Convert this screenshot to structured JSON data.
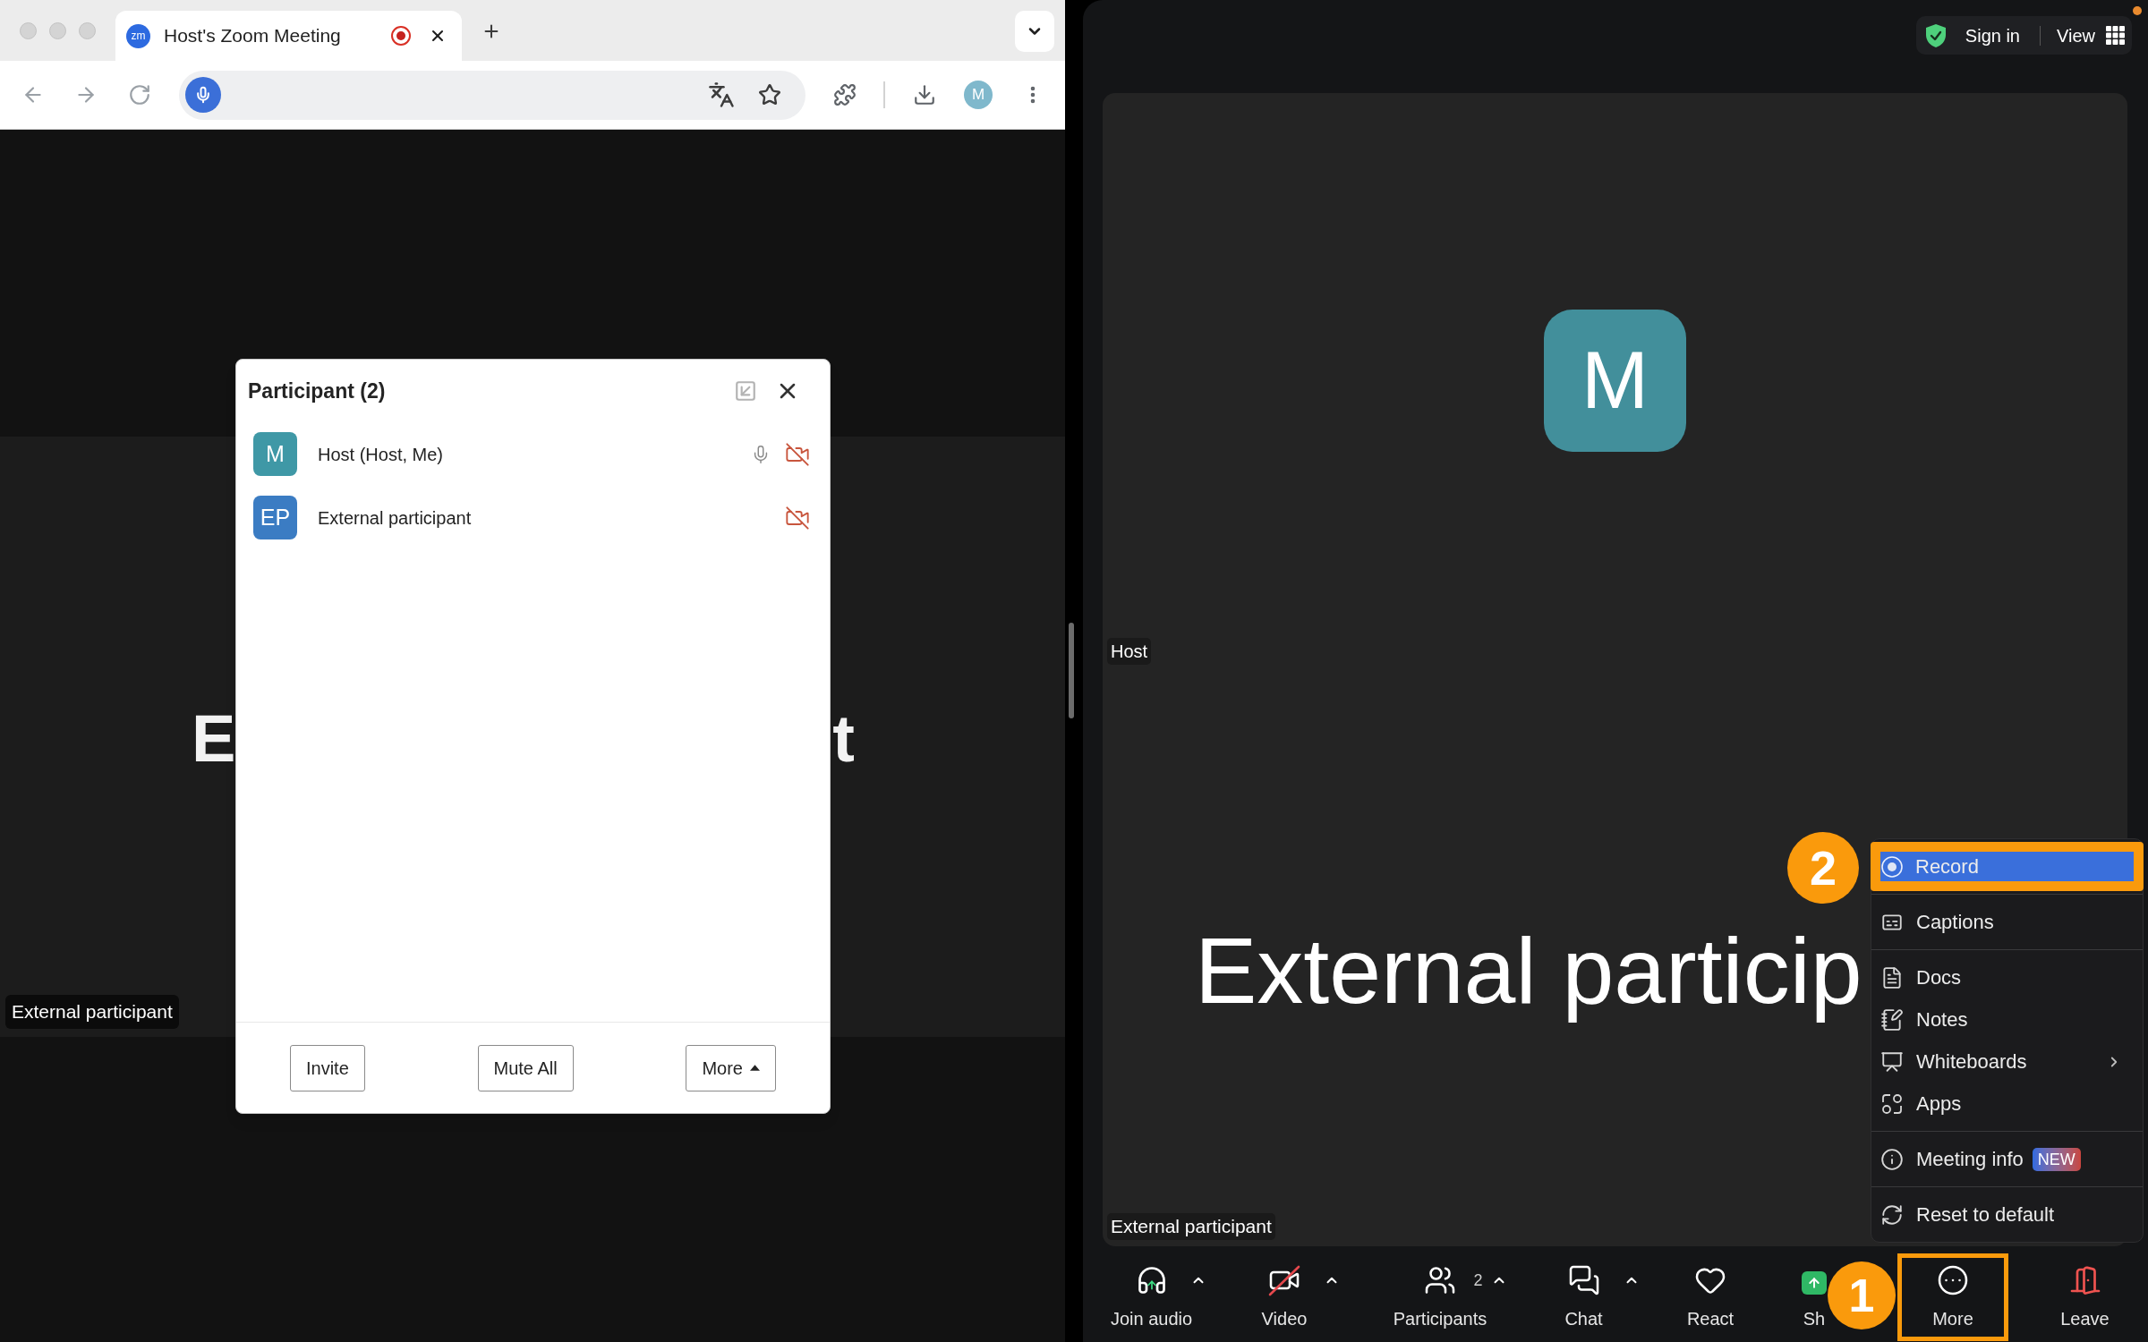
{
  "browser": {
    "tab": {
      "favicon_text": "zm",
      "title": "Host's Zoom Meeting",
      "recording": true
    },
    "profile_initial": "M"
  },
  "left_view": {
    "name_fragments": [
      "E",
      "t"
    ],
    "name_label": "External participant"
  },
  "participants_panel": {
    "title": "Participant (2)",
    "participants": [
      {
        "initials": "M",
        "name": "Host (Host, Me)",
        "color": "#3f98a6",
        "mic": true,
        "video_off": true
      },
      {
        "initials": "EP",
        "name": "External participant",
        "color": "#3b7cc3",
        "mic": false,
        "video_off": true
      }
    ],
    "buttons": [
      {
        "label": "Invite",
        "kind": "plain"
      },
      {
        "label": "Mute All",
        "kind": "plain"
      },
      {
        "label": "More",
        "kind": "menu"
      }
    ]
  },
  "top_bar": {
    "sign_in": "Sign in",
    "view": "View"
  },
  "stage": {
    "avatar_initial": "M",
    "host_label": "Host",
    "big_name": "External particip",
    "name_label": "External participant"
  },
  "more_menu": {
    "step_badge": "2",
    "groups": [
      [
        {
          "kind": "record",
          "label": "Record",
          "selected": true,
          "highlighted": true,
          "submenu": false
        }
      ],
      [
        {
          "kind": "captions",
          "label": "Captions",
          "selected": false,
          "highlighted": false,
          "submenu": false
        }
      ],
      [
        {
          "kind": "docs",
          "label": "Docs",
          "selected": false,
          "highlighted": false,
          "submenu": false
        },
        {
          "kind": "notes",
          "label": "Notes",
          "selected": false,
          "highlighted": false,
          "submenu": false
        },
        {
          "kind": "whiteboards",
          "label": "Whiteboards",
          "selected": false,
          "highlighted": false,
          "submenu": true
        },
        {
          "kind": "apps",
          "label": "Apps",
          "selected": false,
          "highlighted": false,
          "submenu": false
        }
      ],
      [
        {
          "kind": "info",
          "label": "Meeting info",
          "badge": "NEW",
          "selected": false,
          "highlighted": false,
          "submenu": false
        }
      ],
      [
        {
          "kind": "reset",
          "label": "Reset to default",
          "selected": false,
          "highlighted": false,
          "submenu": false
        }
      ]
    ]
  },
  "toolbar": {
    "step_badge": "1",
    "items": [
      {
        "kind": "audio",
        "label": "Join audio",
        "caret": true,
        "off": false,
        "highlighted": false
      },
      {
        "kind": "video",
        "label": "Video",
        "caret": true,
        "off": true,
        "highlighted": false
      },
      {
        "kind": "participants",
        "label": "Participants",
        "count": "2",
        "caret": true,
        "off": false,
        "highlighted": false
      },
      {
        "kind": "chat",
        "label": "Chat",
        "caret": true,
        "off": false,
        "highlighted": false
      },
      {
        "kind": "react",
        "label": "React",
        "caret": false,
        "off": false,
        "highlighted": false
      },
      {
        "kind": "share",
        "label": "Sh",
        "caret": false,
        "off": false,
        "highlighted": false
      },
      {
        "kind": "more",
        "label": "More",
        "caret": false,
        "off": false,
        "highlighted": true
      },
      {
        "kind": "leave",
        "label": "Leave",
        "caret": false,
        "off": false,
        "highlighted": false
      }
    ]
  }
}
